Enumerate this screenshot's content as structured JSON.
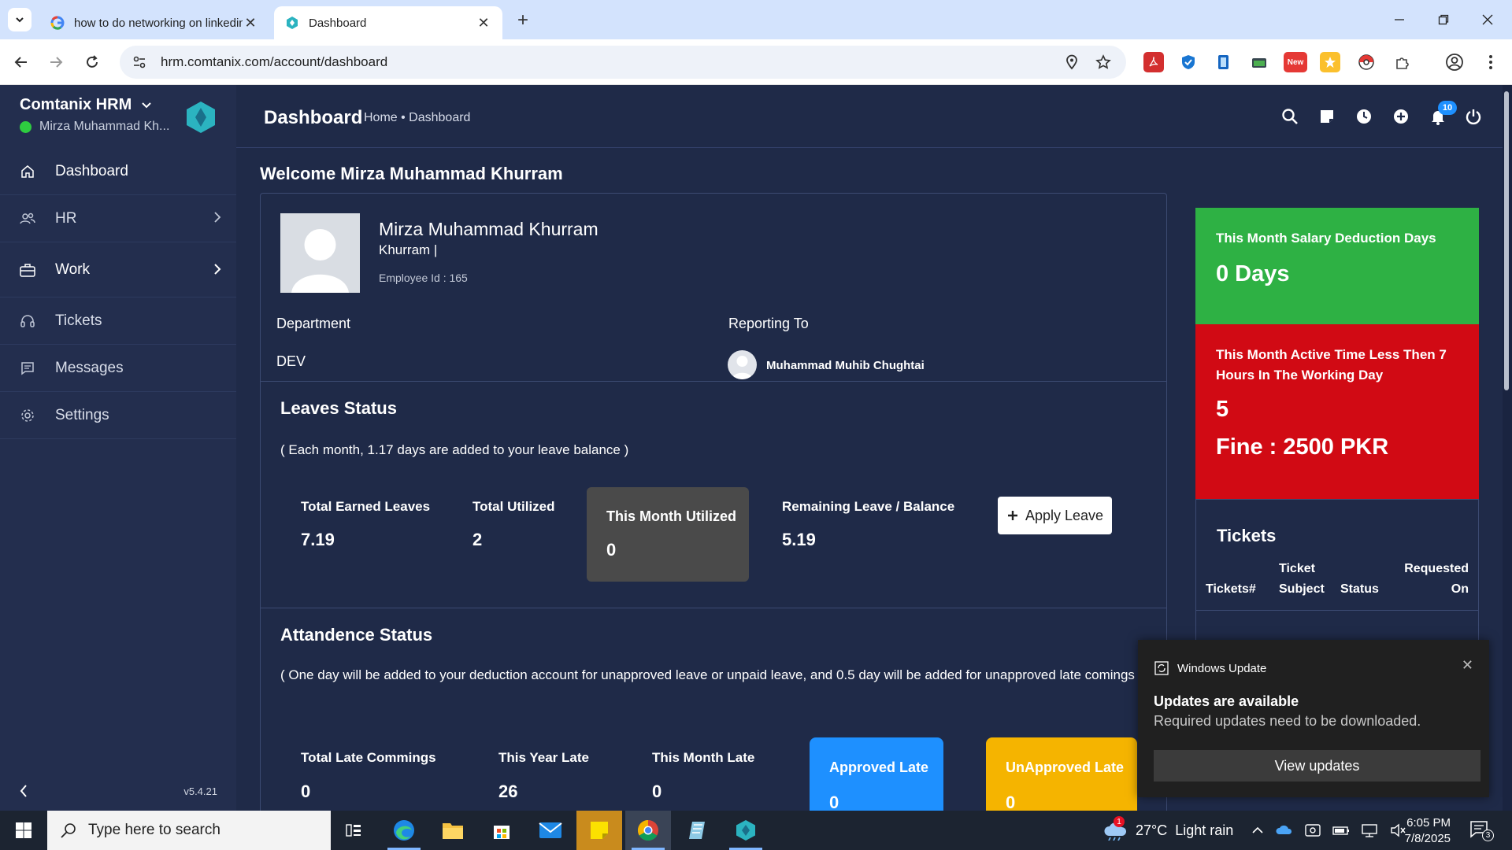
{
  "browser": {
    "tabs": [
      {
        "title": "how to do networking on linkedin - Google Search",
        "active": false
      },
      {
        "title": "Dashboard",
        "active": true
      }
    ],
    "url": "hrm.comtanix.com/account/dashboard",
    "extensions": [
      {
        "name": "pdf-icon",
        "color": "#d32f2f"
      },
      {
        "name": "shield-icon",
        "color": "#1976d2"
      },
      {
        "name": "document-icon",
        "color": "#1565c0"
      },
      {
        "name": "folder-icon",
        "color": "#37474f"
      },
      {
        "name": "new-badge-icon",
        "color": "#e53935",
        "label": "New"
      },
      {
        "name": "star-ext-icon",
        "color": "#fbc02d"
      },
      {
        "name": "pokeball-icon",
        "color": "#e53935"
      },
      {
        "name": "puzzle-icon",
        "color": "#444444"
      }
    ]
  },
  "sidebar": {
    "brand": "Comtanix HRM",
    "user": "Mirza Muhammad Kh...",
    "items": [
      {
        "label": "Dashboard",
        "icon": "home-icon",
        "active": true
      },
      {
        "label": "HR",
        "icon": "users-icon"
      },
      {
        "label": "Work",
        "icon": "briefcase-icon"
      },
      {
        "label": "Tickets",
        "icon": "headset-icon"
      },
      {
        "label": "Messages",
        "icon": "message-icon"
      },
      {
        "label": "Settings",
        "icon": "gear-icon"
      }
    ],
    "version": "v5.4.21"
  },
  "header": {
    "title": "Dashboard",
    "breadcrumb": "Home • Dashboard",
    "notification_count": "10"
  },
  "welcome": "Welcome Mirza Muhammad Khurram",
  "profile": {
    "name": "Mirza Muhammad Khurram",
    "short_name": "Khurram |",
    "employee_id": "Employee Id : 165",
    "department_label": "Department",
    "department": "DEV",
    "reporting_label": "Reporting To",
    "reporting_to": "Muhammad Muhib Chughtai"
  },
  "leaves": {
    "title": "Leaves Status",
    "note": "( Each month, 1.17 days are added to your leave balance )",
    "earned_label": "Total Earned Leaves",
    "earned": "7.19",
    "utilized_label": "Total Utilized",
    "utilized": "2",
    "month_label": "This Month Utilized",
    "month": "0",
    "remaining_label": "Remaining Leave / Balance",
    "remaining": "5.19",
    "apply_label": "Apply Leave"
  },
  "attendance": {
    "title": "Attandence Status",
    "note": "( One day will be added to your deduction account for unapproved leave or unpaid leave, and 0.5 day will be added for unapproved late comings )",
    "late_label": "Total Late Commings",
    "late": "0",
    "year_label": "This Year Late",
    "year": "26",
    "month_label": "This Month Late",
    "month": "0",
    "approved_label": "Approved Late",
    "approved": "0",
    "unapproved_label": "UnApproved Late",
    "unapproved": "0"
  },
  "salary_panel": {
    "title": "This Month Salary Deduction Days",
    "value": "0 Days",
    "color": "#2eb144"
  },
  "active_panel": {
    "title": "This Month Active Time Less Then 7 Hours In The Working Day",
    "count": "5",
    "fine": "Fine : 2500 PKR",
    "color": "#d10a14"
  },
  "tickets": {
    "title": "Tickets",
    "col1": "Tickets#",
    "col2_line1": "Ticket",
    "col2_line2": "Subject",
    "col3": "Status",
    "col4_line1": "Requested",
    "col4_line2": "On"
  },
  "toast": {
    "app": "Windows Update",
    "title": "Updates are available",
    "message": "Required updates need to be downloaded.",
    "button": "View updates"
  },
  "taskbar": {
    "search_placeholder": "Type here to search",
    "weather": "27°C  Light rain",
    "weather_badge": "1",
    "time": "6:05 PM",
    "date": "7/8/2025",
    "notifications": "3"
  }
}
